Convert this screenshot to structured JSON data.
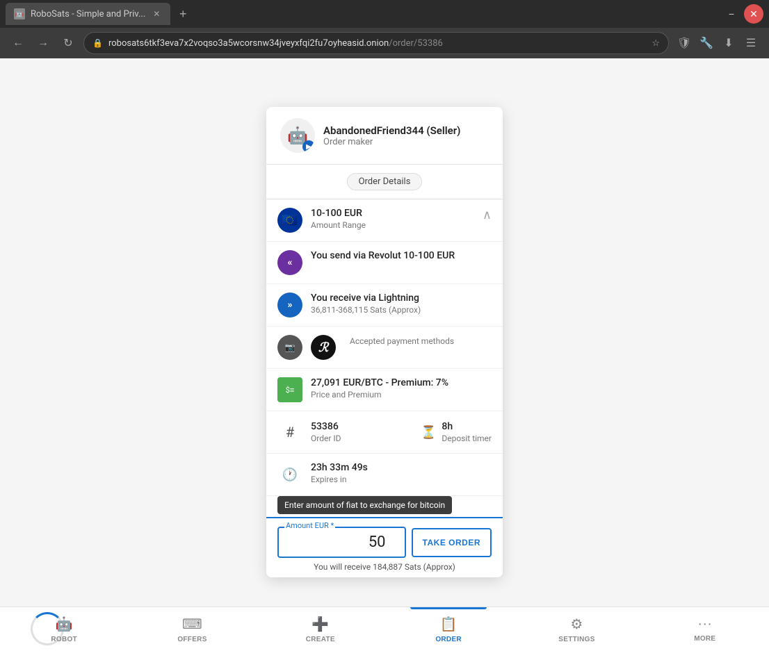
{
  "browser": {
    "tab_title": "RoboSats - Simple and Priv...",
    "url_base": "robosats6tkf3eva7x2voqso3a5wcorsnw34jveyxfqi2fu7oyheasid.onion",
    "url_path": "/order/53386",
    "new_tab_label": "+",
    "win_min": "−",
    "win_close": "✕"
  },
  "card": {
    "seller_name": "AbandonedFriend344 (Seller)",
    "order_maker": "Order maker",
    "section_label": "Order Details",
    "amount_range": "10-100 EUR",
    "amount_range_sub": "Amount Range",
    "send_text": "You send via Revolut 10-100 EUR",
    "receive_text": "You receive via Lightning",
    "receive_sats": "36,811-368,115 Sats (Approx)",
    "payment_method": "Revolut",
    "payment_sub": "Accepted payment methods",
    "price_text": "27,091 EUR/BTC - Premium: 7%",
    "price_sub": "Price and Premium",
    "order_id": "53386",
    "order_id_sub": "Order ID",
    "deposit_timer": "8h",
    "deposit_sub": "Deposit timer",
    "expires": "23h 33m 49s",
    "expires_sub": "Expires in",
    "tooltip_text": "Enter amount of fiat to exchange for bitcoin",
    "amount_label": "Amount EUR *",
    "amount_value": "50",
    "take_order_btn": "TAKE ORDER",
    "receive_sats_result": "You will receive 184,887 Sats (Approx)"
  },
  "bottom_nav": {
    "robot_label": "ROBOT",
    "offers_label": "OFFERS",
    "create_label": "CREATE",
    "order_label": "ORDER",
    "settings_label": "SETTINGS",
    "more_label": "MORE"
  }
}
